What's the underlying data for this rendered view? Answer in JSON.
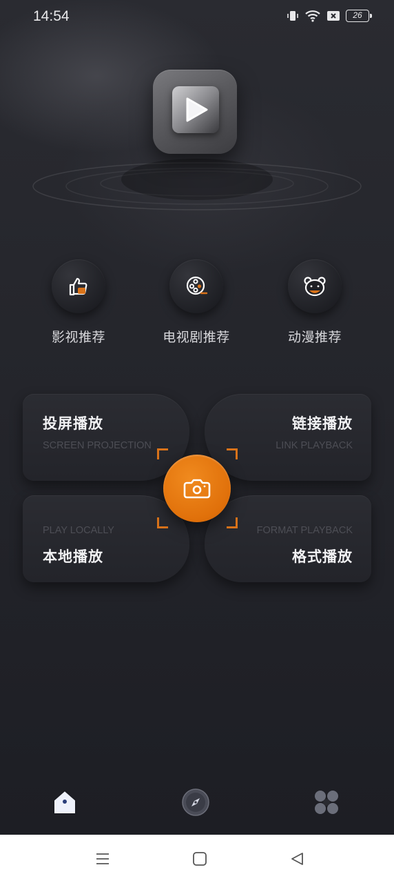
{
  "status_bar": {
    "time": "14:54",
    "battery_level": "26",
    "icons": [
      "vibrate-icon",
      "wifi-icon",
      "sim-off-icon",
      "battery-icon"
    ]
  },
  "app_logo": {
    "icon": "play-icon"
  },
  "categories": [
    {
      "label": "影视推荐",
      "icon": "thumbs-up-icon"
    },
    {
      "label": "电视剧推荐",
      "icon": "film-reel-icon"
    },
    {
      "label": "动漫推荐",
      "icon": "bear-icon"
    }
  ],
  "actions": {
    "screen_projection": {
      "title": "投屏播放",
      "subtitle": "SCREEN PROJECTION"
    },
    "link_playback": {
      "title": "链接播放",
      "subtitle": "LINK PLAYBACK"
    },
    "play_locally": {
      "title": "本地播放",
      "subtitle": "PLAY LOCALLY"
    },
    "format_playback": {
      "title": "格式播放",
      "subtitle": "FORMAT PLAYBACK"
    },
    "center_button_icon": "camera-icon"
  },
  "bottom_tabs": [
    {
      "name": "home",
      "icon": "home-icon",
      "active": true
    },
    {
      "name": "discover",
      "icon": "compass-icon",
      "active": false
    },
    {
      "name": "more",
      "icon": "apps-grid-icon",
      "active": false
    }
  ],
  "system_nav": [
    "menu-icon",
    "home-square-icon",
    "back-triangle-icon"
  ],
  "colors": {
    "accent": "#e8780f",
    "background": "#22232a",
    "card": "#26272d"
  }
}
